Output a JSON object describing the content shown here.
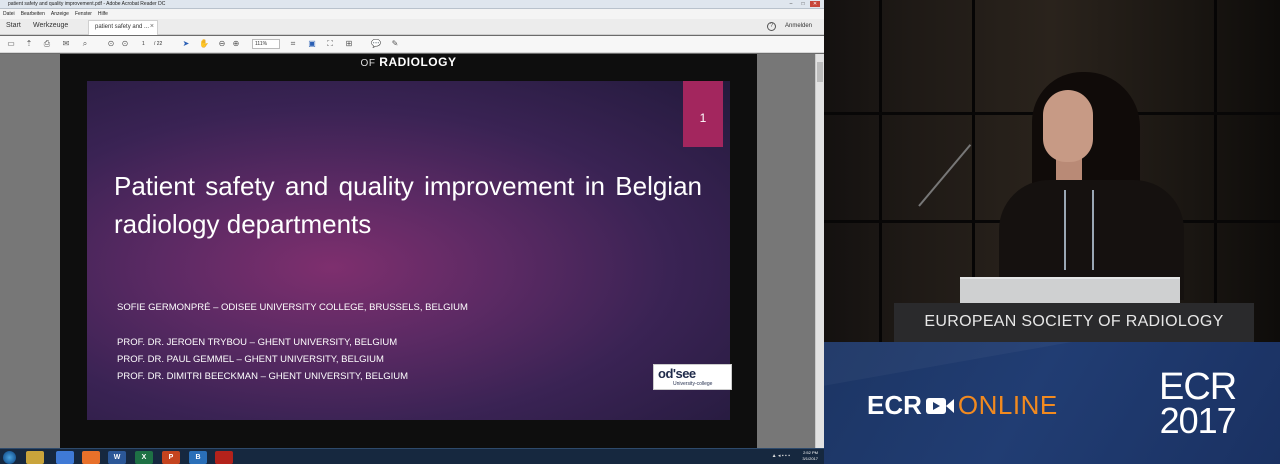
{
  "window": {
    "title": "patient safety and quality improvement.pdf - Adobe Acrobat Reader DC",
    "controls": [
      "–",
      "□",
      "✕"
    ]
  },
  "menu": [
    "Datei",
    "Bearbeiten",
    "Anzeige",
    "Fenster",
    "Hilfe"
  ],
  "tabs": {
    "start": "Start",
    "tools": "Werkzeuge",
    "document": "patient safety and ...",
    "close": "×",
    "signin": "Anmelden",
    "help": "?"
  },
  "toolbar": {
    "page_current": "1",
    "page_total": "/ 22",
    "zoom": "111%",
    "icons": [
      "save-icon",
      "upload-icon",
      "print-icon",
      "email-icon",
      "search-icon",
      "previous-page-icon",
      "next-page-icon",
      "select-cursor-icon",
      "hand-icon",
      "zoom-out-icon",
      "zoom-in-icon",
      "crop-icon",
      "fit-page-icon",
      "fullscreen-icon",
      "more-tools-icon",
      "comment-icon",
      "pen-icon"
    ]
  },
  "pdf": {
    "header_fragment": "OF RADIOLOGY",
    "header_of": "OF",
    "header_word": "RADIOLOGY",
    "slide_number": "1",
    "title": "Patient safety and quality improvement in Belgian radiology departments",
    "author": "SOFIE GERMONPRÉ – ODISEE UNIVERSITY COLLEGE, BRUSSELS, BELGIUM",
    "coauthors": [
      "PROF. DR. JEROEN TRYBOU – GHENT UNIVERSITY, BELGIUM",
      "PROF. DR. PAUL GEMMEL – GHENT UNIVERSITY, BELGIUM",
      "PROF. DR. DIMITRI BEECKMAN – GHENT UNIVERSITY, BELGIUM"
    ],
    "logo_text": "od'see",
    "logo_sub": "University-college"
  },
  "taskbar": {
    "apps": [
      {
        "name": "explorer",
        "label": "",
        "color": "#c9a43b"
      },
      {
        "name": "chrome",
        "label": "",
        "color": "#3f7ad6"
      },
      {
        "name": "firefox",
        "label": "",
        "color": "#e8702a"
      },
      {
        "name": "word",
        "label": "W",
        "color": "#2b5797"
      },
      {
        "name": "excel",
        "label": "X",
        "color": "#1e7145"
      },
      {
        "name": "powerpoint",
        "label": "P",
        "color": "#c5441f"
      },
      {
        "name": "skype-business",
        "label": "B",
        "color": "#2a6fb8"
      },
      {
        "name": "acrobat",
        "label": "",
        "color": "#b3221b"
      }
    ],
    "time": "2:52 PM",
    "date": "3/1/2017",
    "tray": "▲ ◂ ▪ ▪ ▪"
  },
  "video": {
    "lectern_text": "EUROPEAN SOCIETY OF RADIOLOGY",
    "banner_ecr": "ECR",
    "banner_online": "ONLINE",
    "banner_event": "ECR",
    "banner_year": "2017"
  },
  "colors": {
    "slide_badge": "#a3265e",
    "online_orange": "#f28a1f",
    "banner_blue": "#1c3564"
  }
}
